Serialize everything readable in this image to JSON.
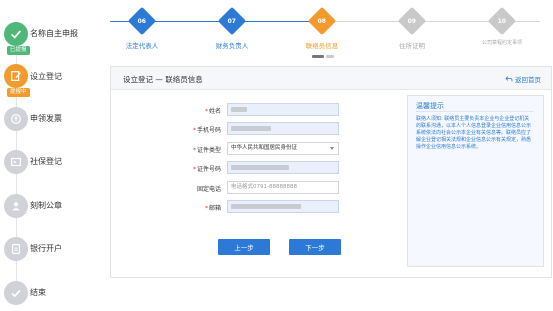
{
  "sidebar": {
    "steps": [
      {
        "label": "名称自主申报",
        "tag": "已提报",
        "status": "done",
        "icon": "check-icon"
      },
      {
        "label": "设立登记",
        "tag": "提报中",
        "status": "current",
        "icon": "edit-icon"
      },
      {
        "label": "申领发票",
        "status": "pending",
        "icon": "invoice-icon"
      },
      {
        "label": "社保登记",
        "status": "pending",
        "icon": "social-insurance-icon"
      },
      {
        "label": "刻制公章",
        "status": "pending",
        "icon": "user-icon"
      },
      {
        "label": "银行开户",
        "status": "pending",
        "icon": "bank-icon"
      },
      {
        "label": "结束",
        "status": "pending",
        "icon": "finish-check-icon"
      }
    ]
  },
  "stepper": {
    "steps": [
      {
        "num": "06",
        "label": "法定代表人",
        "state": "done"
      },
      {
        "num": "07",
        "label": "财务负责人",
        "state": "done"
      },
      {
        "num": "08",
        "label": "联络员信息",
        "state": "current"
      },
      {
        "num": "09",
        "label": "住所证明",
        "state": "pending"
      },
      {
        "num": "10",
        "label": "公司章程约定事项",
        "state": "pending"
      }
    ]
  },
  "panel": {
    "title": "设立登记 — 联络员信息",
    "back_label": "返回首页"
  },
  "form": {
    "name_label": "姓名",
    "phone_label": "手机号码",
    "id_type_label": "证件类型",
    "id_type_value": "中华人民共和国居民身份证",
    "id_number_label": "证件号码",
    "landline_label": "固定电话",
    "landline_placeholder": "电话格式0791-88888888",
    "email_label": "邮箱"
  },
  "buttons": {
    "prev": "上一步",
    "next": "下一步"
  },
  "tips": {
    "title": "温馨提示",
    "body": "联络人须知: 联络员主要负责本企业与企业登记机关的联系沟通，以本人个人信息登录企业信用信息公示系统依法向社会公示本企业有关信息等。联络员应了解企业登记相关法规和企业信息公示有关规定，熟悉操作企业信用信息公示系统。"
  },
  "colors": {
    "accent": "#2c7ad6",
    "current": "#f39a2c",
    "done": "#4fb878",
    "required": "#e03b3b"
  }
}
